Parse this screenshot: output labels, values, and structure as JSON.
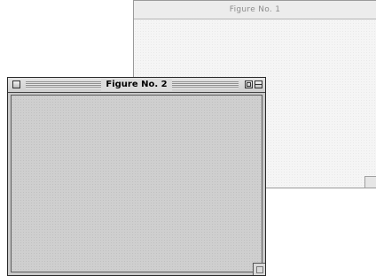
{
  "windows": [
    {
      "title": "Figure No. 1",
      "state": "inactive"
    },
    {
      "title": "Figure No. 2",
      "state": "active"
    }
  ]
}
